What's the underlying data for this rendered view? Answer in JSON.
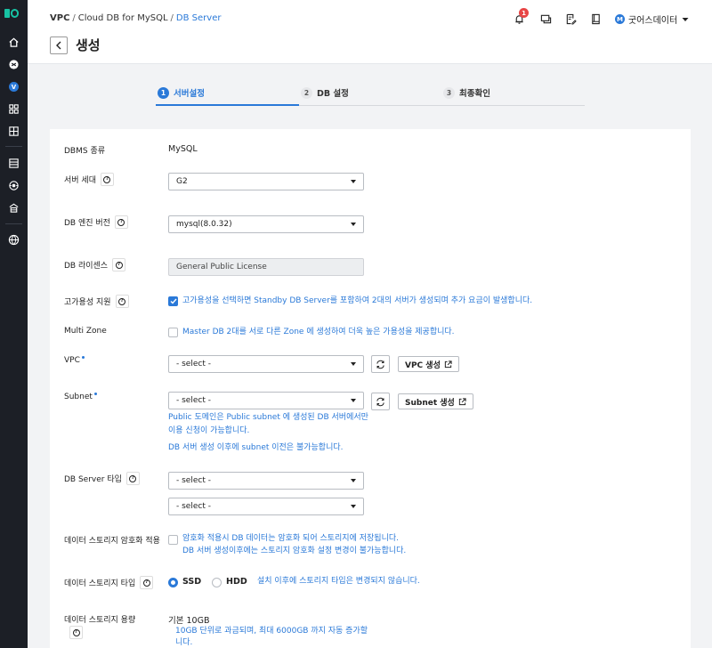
{
  "header": {
    "breadcrumb": [
      "VPC",
      "Cloud DB for MySQL",
      "DB Server"
    ],
    "title": "생성",
    "notification_count": "1",
    "user_initial": "M",
    "user_name": "굿어스데이터"
  },
  "steps": [
    {
      "num": "1",
      "label": "서버설정",
      "active": true
    },
    {
      "num": "2",
      "label": "DB 설정",
      "active": false
    },
    {
      "num": "3",
      "label": "최종확인",
      "active": false
    }
  ],
  "form": {
    "dbms": {
      "label": "DBMS 종류",
      "value": "MySQL"
    },
    "server_gen": {
      "label": "서버 세대",
      "value": "G2"
    },
    "engine": {
      "label": "DB 엔진 버전",
      "value": "mysql(8.0.32)"
    },
    "license": {
      "label": "DB 라이센스",
      "value": "General Public License"
    },
    "ha": {
      "label": "고가용성 지원",
      "checked": true,
      "text": "고가용성을 선택하면 Standby DB Server를 포함하여 2대의 서버가 생성되며 추가 요금이 발생합니다."
    },
    "multizone": {
      "label": "Multi Zone",
      "checked": false,
      "text": "Master DB 2대를 서로 다른 Zone 에 생성하여 더욱 높은 가용성을 제공합니다."
    },
    "vpc": {
      "label": "VPC",
      "value": "- select -",
      "button": "VPC 생성"
    },
    "subnet": {
      "label": "Subnet",
      "value": "- select -",
      "button": "Subnet 생성",
      "hint1_line1": "Public 도메인은 Public subnet 에 생성된 DB 서버에서만",
      "hint1_line2": "이용 신청이 가능합니다.",
      "hint2": "DB 서버 생성 이후에 subnet 이전은 불가능합니다."
    },
    "server_type": {
      "label": "DB Server 타입",
      "value1": "- select -",
      "value2": "- select -"
    },
    "encrypt": {
      "label": "데이터 스토리지 암호화 적용",
      "checked": false,
      "line1": "암호화 적용시 DB 데이터는 암호화 되어 스토리지에 저장됩니다.",
      "line2": "DB 서버 생성이후에는 스토리지 암호화 설정 변경이 불가능합니다."
    },
    "storage_type": {
      "label": "데이터 스토리지 타입",
      "options": [
        "SSD",
        "HDD"
      ],
      "selected": "SSD",
      "hint": "설치 이후에 스토리지 타입은 변경되지 않습니다."
    },
    "storage_size": {
      "label": "데이터 스토리지 용량",
      "value": "기본 10GB",
      "hint_line1": "10GB 단위로 과금되며, 최대 6000GB 까지 자동 증가할",
      "hint_line2": "니다."
    }
  },
  "colors": {
    "accent": "#2a79d8",
    "sidebar": "#1c1f26",
    "brand": "#17c3a4"
  }
}
